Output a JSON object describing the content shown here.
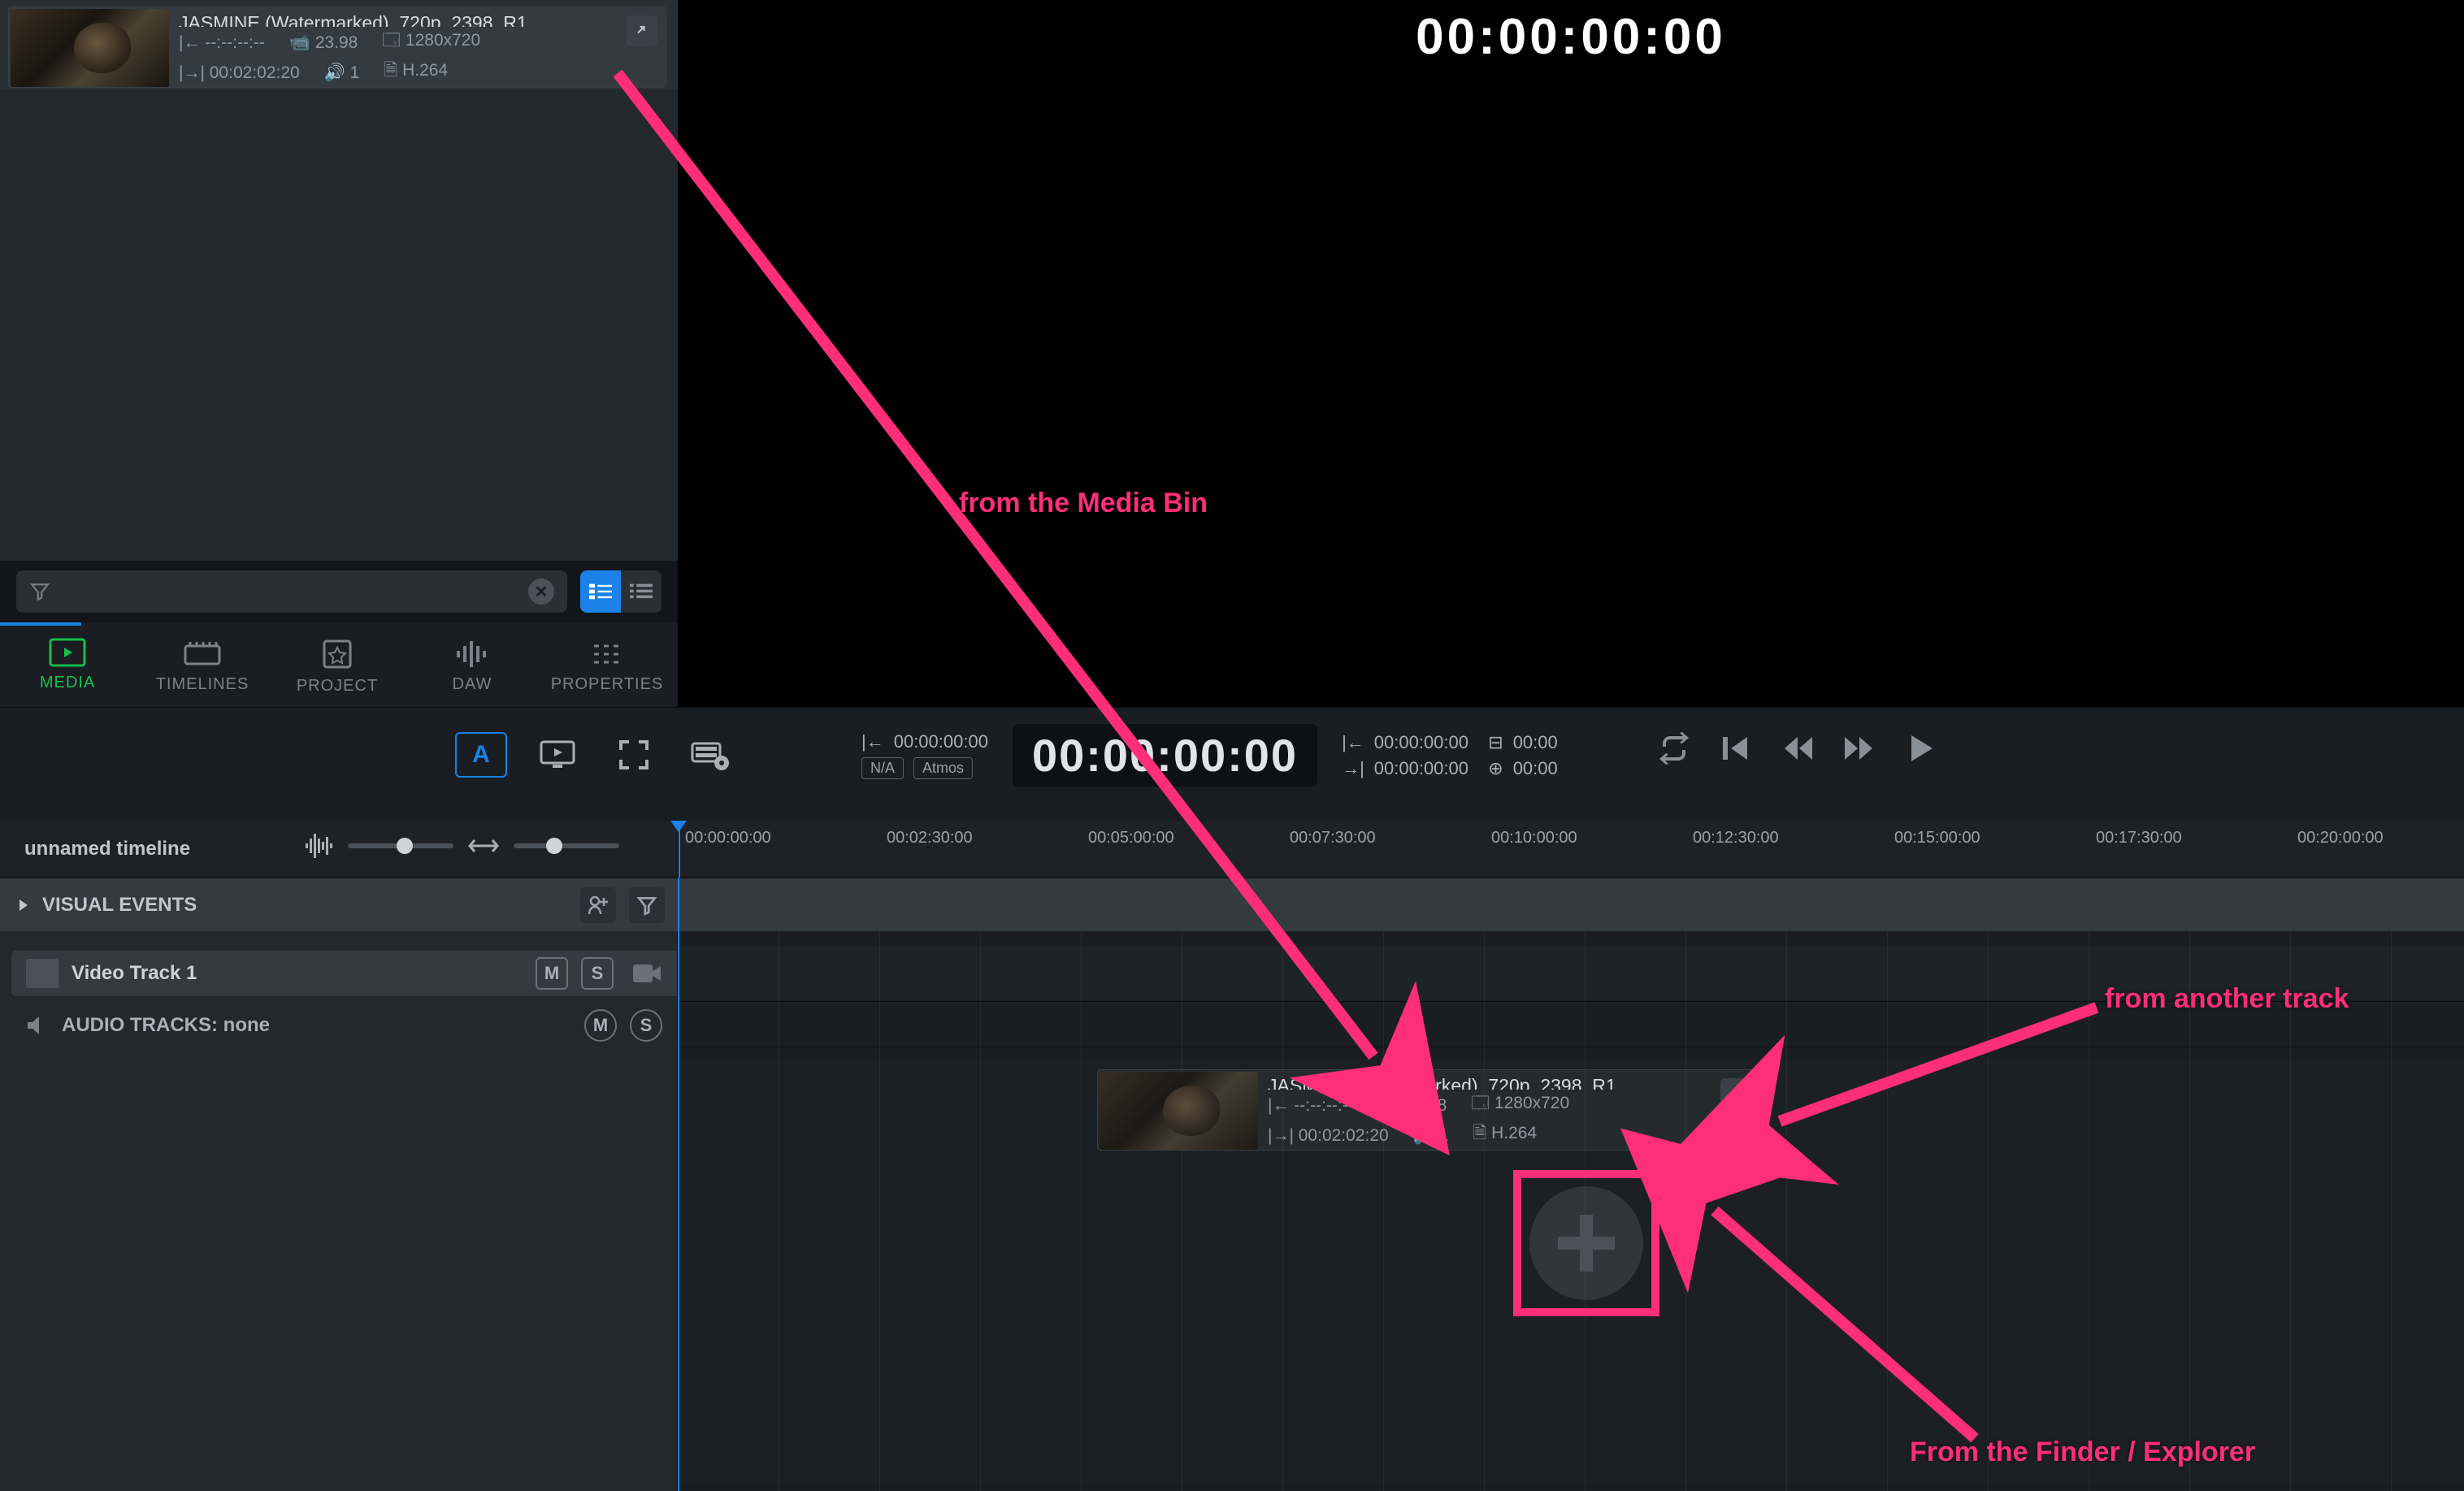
{
  "viewer": {
    "timecode_big": "00:00:00:00"
  },
  "media_bin": {
    "clip": {
      "title": "JASMINE (Watermarked)_720p_2398_R1_...",
      "tc_in": "--:--:--:--",
      "fps": "23.98",
      "resolution": "1280x720",
      "duration": "00:02:02:20",
      "channels": "1",
      "codec": "H.264"
    },
    "filter_placeholder": ""
  },
  "tabs": [
    {
      "id": "media",
      "label": "MEDIA",
      "active": true
    },
    {
      "id": "timelines",
      "label": "TIMELINES",
      "active": false
    },
    {
      "id": "project",
      "label": "PROJECT",
      "active": false
    },
    {
      "id": "daw",
      "label": "DAW",
      "active": false
    },
    {
      "id": "properties",
      "label": "PROPERTIES",
      "active": false
    }
  ],
  "toolbar": {
    "a_label": "A",
    "in_tc": "00:00:00:00",
    "pill_na": "N/A",
    "pill_atmos": "Atmos",
    "center_tc": "00:00:00:00",
    "range_in": "00:00:00:00",
    "range_out": "00:00:00:00",
    "dur_1": "00:00",
    "dur_2": "00:00"
  },
  "timeline": {
    "name": "unnamed timeline",
    "visual_events": "VISUAL EVENTS",
    "ticks": [
      "00:00:00:00",
      "00:02:30:00",
      "00:05:00:00",
      "00:07:30:00",
      "00:10:00:00",
      "00:12:30:00",
      "00:15:00:00",
      "00:17:30:00",
      "00:20:00:00"
    ]
  },
  "tracks": {
    "video_track": "Video Track 1",
    "audio_tracks": "AUDIO TRACKS: none",
    "m": "M",
    "s": "S"
  },
  "ghost_clip": {
    "title": "JASMINE (Watermarked)_720p_2398_R1_...",
    "tc_in": "--:--:--:--",
    "fps": "23.98",
    "resolution": "1280x720",
    "duration": "00:02:02:20",
    "channels": "1",
    "codec": "H.264"
  },
  "annotations": {
    "from_bin": "from the Media Bin",
    "from_track": "from another track",
    "from_finder": "From the Finder / Explorer"
  }
}
